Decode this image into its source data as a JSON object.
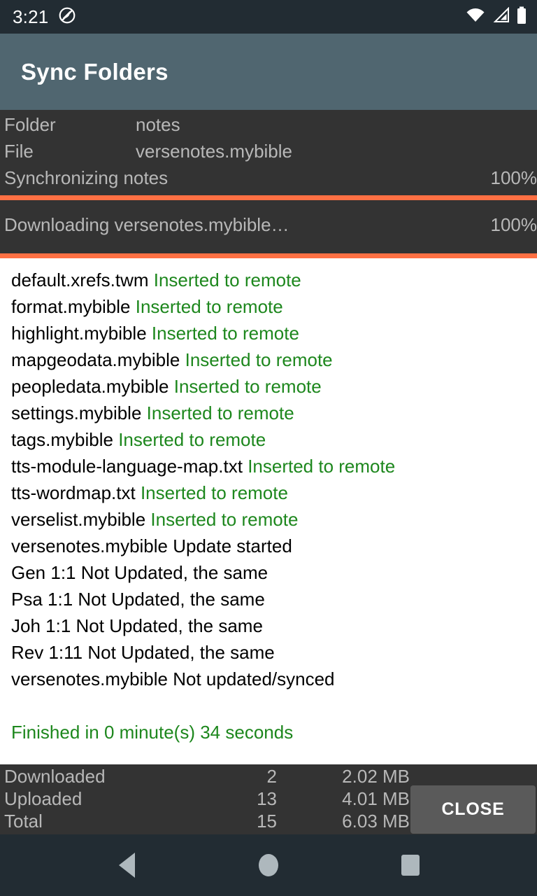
{
  "status_bar": {
    "time": "3:21",
    "icons": [
      "do-not-disturb-icon",
      "wifi-icon",
      "cell-signal-icon",
      "battery-icon"
    ]
  },
  "app_bar": {
    "title": "Sync Folders"
  },
  "sync_status": {
    "folder_label": "Folder",
    "folder_value": "notes",
    "file_label": "File",
    "file_value": "versenotes.mybible",
    "main_task_label": "Synchronizing notes",
    "main_task_percent": "100%",
    "main_task_value": 100,
    "sub_task_label": "Downloading versenotes.mybible…",
    "sub_task_percent": "100%",
    "sub_task_value": 100,
    "progress_color": "#ff7043"
  },
  "log": {
    "success_color": "#1d871d",
    "lines": [
      {
        "file": "default.xrefs.twm",
        "status": "Inserted to remote",
        "status_kind": "ok"
      },
      {
        "file": "format.mybible",
        "status": "Inserted to remote",
        "status_kind": "ok"
      },
      {
        "file": "highlight.mybible",
        "status": "Inserted to remote",
        "status_kind": "ok"
      },
      {
        "file": "mapgeodata.mybible",
        "status": "Inserted to remote",
        "status_kind": "ok"
      },
      {
        "file": "peopledata.mybible",
        "status": "Inserted to remote",
        "status_kind": "ok"
      },
      {
        "file": "settings.mybible",
        "status": "Inserted to remote",
        "status_kind": "ok"
      },
      {
        "file": "tags.mybible",
        "status": "Inserted to remote",
        "status_kind": "ok"
      },
      {
        "file": "tts-module-language-map.txt",
        "status": "Inserted to remote",
        "status_kind": "ok"
      },
      {
        "file": "tts-wordmap.txt",
        "status": "Inserted to remote",
        "status_kind": "ok"
      },
      {
        "file": "verselist.mybible",
        "status": "Inserted to remote",
        "status_kind": "ok"
      },
      {
        "file": "versenotes.mybible",
        "status": "Update started",
        "status_kind": "plain"
      },
      {
        "file": "Gen 1:1",
        "status": "Not Updated, the same",
        "status_kind": "plain"
      },
      {
        "file": "Psa 1:1",
        "status": "Not Updated, the same",
        "status_kind": "plain"
      },
      {
        "file": "Joh 1:1",
        "status": "Not Updated, the same",
        "status_kind": "plain"
      },
      {
        "file": "Rev 1:11",
        "status": "Not Updated, the same",
        "status_kind": "plain"
      },
      {
        "file": "versenotes.mybible",
        "status": "Not updated/synced",
        "status_kind": "plain"
      }
    ],
    "finished_text": "Finished in 0 minute(s) 34 seconds"
  },
  "summary": {
    "rows": [
      {
        "label": "Downloaded",
        "count": "2",
        "size": "2.02 MB"
      },
      {
        "label": "Uploaded",
        "count": "13",
        "size": "4.01 MB"
      },
      {
        "label": "Total",
        "count": "15",
        "size": "6.03 MB"
      }
    ],
    "close_label": "CLOSE"
  },
  "nav_bar": {
    "back": "back-icon",
    "home": "home-icon",
    "recents": "recents-icon"
  }
}
